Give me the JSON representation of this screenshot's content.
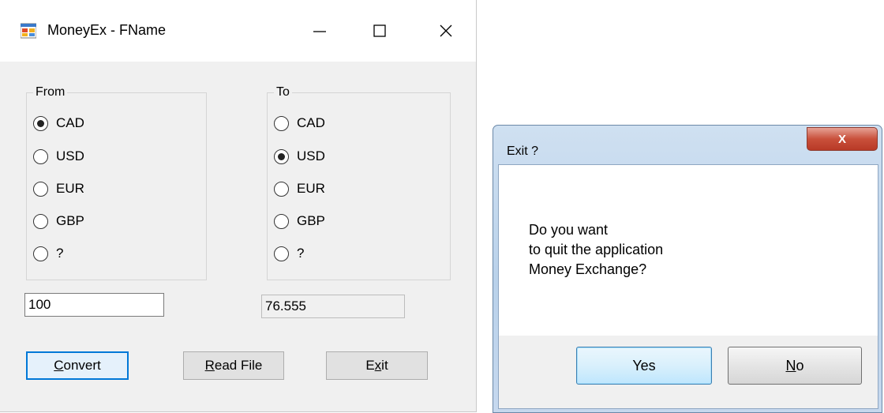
{
  "main_window": {
    "title": "MoneyEx - FName",
    "from_group": {
      "label": "From",
      "options": [
        "CAD",
        "USD",
        "EUR",
        "GBP",
        "?"
      ],
      "selected": "CAD"
    },
    "to_group": {
      "label": "To",
      "options": [
        "CAD",
        "USD",
        "EUR",
        "GBP",
        "?"
      ],
      "selected": "USD"
    },
    "amount_input": {
      "value": "100"
    },
    "result_output": {
      "value": "76.555"
    },
    "buttons": {
      "convert": {
        "mnemonic": "C",
        "rest": "onvert"
      },
      "read_file": {
        "mnemonic": "R",
        "rest": "ead File"
      },
      "exit": {
        "pre": "E",
        "mnemonic": "x",
        "rest": "it"
      }
    }
  },
  "exit_dialog": {
    "title": "Exit ?",
    "close_glyph": "X",
    "message_lines": [
      "Do you want",
      "to quit the application",
      "Money Exchange?"
    ],
    "yes_label": "Yes",
    "no_button": {
      "mnemonic": "N",
      "rest": "o"
    }
  }
}
